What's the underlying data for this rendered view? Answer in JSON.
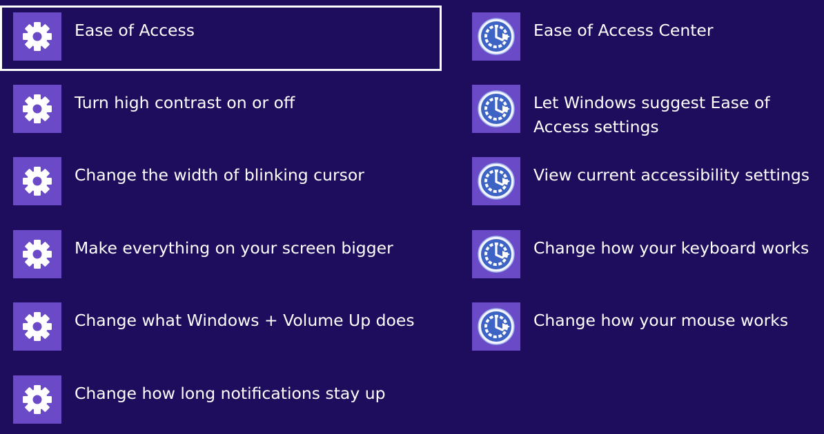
{
  "theme": {
    "background": "#1e0c5c",
    "tile": "#6a4ac6",
    "text": "#ffffff",
    "selection_border": "#ffffff"
  },
  "settings_results": [
    {
      "label": "Ease of Access",
      "icon": "gear-icon",
      "selected": true
    },
    {
      "label": "Turn high contrast on or off",
      "icon": "gear-icon"
    },
    {
      "label": "Change the width of blinking cursor",
      "icon": "gear-icon"
    },
    {
      "label": "Make everything on your screen bigger",
      "icon": "gear-icon"
    },
    {
      "label": "Change what Windows + Volume Up does",
      "icon": "gear-icon"
    },
    {
      "label": "Change how long notifications stay up",
      "icon": "gear-icon"
    }
  ],
  "control_panel_results": [
    {
      "label": "Ease of Access Center",
      "icon": "ease-of-access-icon"
    },
    {
      "label": "Let Windows suggest Ease of Access settings",
      "icon": "ease-of-access-icon"
    },
    {
      "label": "View current accessibility settings",
      "icon": "ease-of-access-icon"
    },
    {
      "label": "Change how your keyboard works",
      "icon": "ease-of-access-icon"
    },
    {
      "label": "Change how your mouse works",
      "icon": "ease-of-access-icon"
    }
  ]
}
